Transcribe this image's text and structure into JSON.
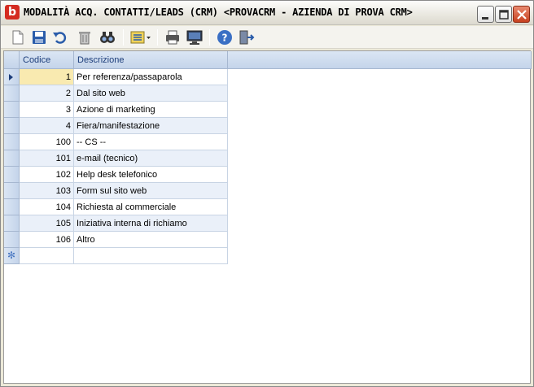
{
  "window": {
    "title": "MODALITÀ ACQ. CONTATTI/LEADS (CRM) <PROVACRM - AZIENDA DI PROVA CRM>",
    "app_icon_letter": "b"
  },
  "toolbar": {
    "buttons": [
      "new-icon",
      "save-icon",
      "undo-icon",
      "delete-icon",
      "find-icon",
      "view-options-icon",
      "print-icon",
      "preview-icon",
      "help-icon",
      "exit-icon"
    ]
  },
  "grid": {
    "columns": [
      "Codice",
      "Descrizione"
    ],
    "rows": [
      {
        "code": "1",
        "desc": "Per referenza/passaparola"
      },
      {
        "code": "2",
        "desc": "Dal sito web"
      },
      {
        "code": "3",
        "desc": "Azione di marketing"
      },
      {
        "code": "4",
        "desc": "Fiera/manifestazione"
      },
      {
        "code": "100",
        "desc": "-- CS --"
      },
      {
        "code": "101",
        "desc": "e-mail (tecnico)"
      },
      {
        "code": "102",
        "desc": "Help desk telefonico"
      },
      {
        "code": "103",
        "desc": "Form sul sito web"
      },
      {
        "code": "104",
        "desc": "Richiesta al commerciale"
      },
      {
        "code": "105",
        "desc": "Iniziativa interna di richiamo"
      },
      {
        "code": "106",
        "desc": "Altro"
      }
    ],
    "new_row_marker": "✻"
  }
}
